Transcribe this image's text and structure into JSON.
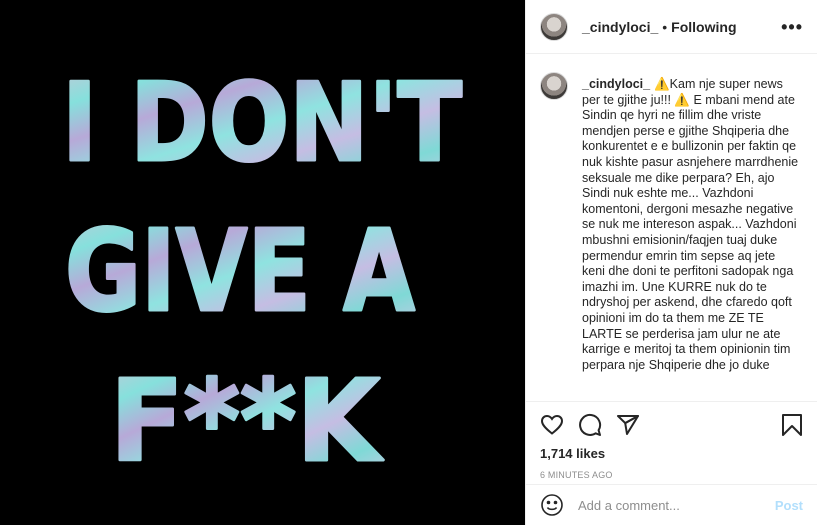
{
  "media": {
    "background": "#000000",
    "slogan_lines": [
      "I DON'T",
      "GIVE A",
      "F**K"
    ]
  },
  "header": {
    "username": "_cindyloci_",
    "separator": "•",
    "follow_status": "Following",
    "more_icon": "more-horizontal-icon",
    "more_label": "•••"
  },
  "caption": {
    "username": "_cindyloci_",
    "text": "⚠️Kam nje super news per te gjithe ju!!! ⚠️ E mbani mend ate Sindin qe hyri ne fillim dhe vriste mendjen perse e gjithe Shqiperia dhe konkurentet e e bullizonin per faktin qe nuk kishte pasur asnjehere marrdhenie seksuale me dike perpara? Eh, ajo Sindi nuk eshte me... Vazhdoni komentoni, dergoni mesazhe negative se nuk me intereson aspak... Vazhdoni mbushni emisionin/faqjen tuaj duke permendur emrin tim sepse aq jete keni dhe doni te perfitoni sadopak nga imazhi im. Une KURRE nuk do te ndryshoj per askend, dhe cfaredo qoft opinioni im do ta them me ZE TE LARTE se perderisa jam ulur ne ate karrige e meritoj ta them opinionin tim perpara nje Shqiperie dhe jo duke"
  },
  "actions": {
    "icons": [
      "heart-icon",
      "comment-icon",
      "share-icon",
      "bookmark-icon"
    ]
  },
  "likes": "1,714 likes",
  "timestamp": "6 MINUTES AGO",
  "comment_box": {
    "placeholder": "Add a comment...",
    "post_label": "Post",
    "emoji_icon": "smiley-icon"
  },
  "colors": {
    "post_button": "#b2dffc",
    "muted": "#8e8e8e",
    "text": "#262626"
  }
}
